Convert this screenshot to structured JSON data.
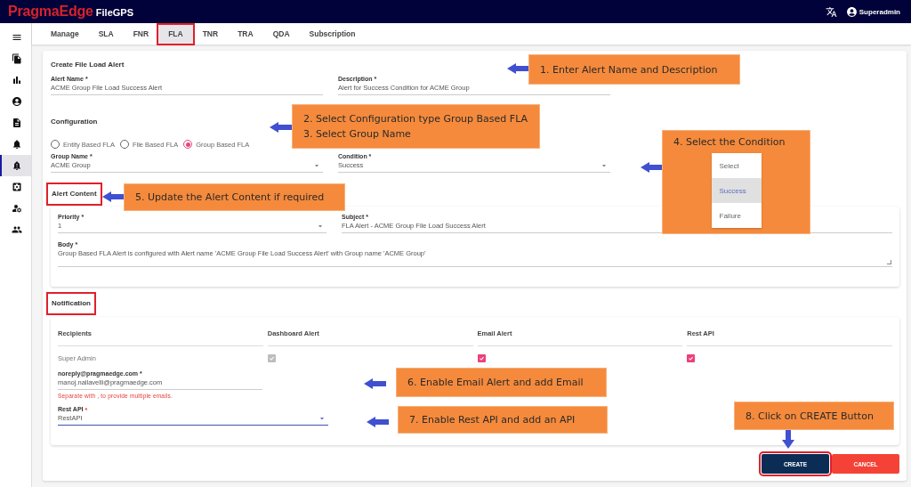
{
  "header": {
    "brand": "PragmaEdge",
    "product": "FileGPS",
    "user": "Superadmin"
  },
  "sidebar": {
    "items": [
      {
        "selected": false
      },
      {
        "selected": false
      },
      {
        "selected": false
      },
      {
        "selected": false
      },
      {
        "selected": false
      },
      {
        "selected": true
      },
      {
        "selected": false
      },
      {
        "selected": false
      },
      {
        "selected": false
      }
    ]
  },
  "tabs": [
    {
      "label": "Manage",
      "selected": false,
      "highlighted": false
    },
    {
      "label": "SLA",
      "selected": false,
      "highlighted": false
    },
    {
      "label": "FNR",
      "selected": false,
      "highlighted": false
    },
    {
      "label": "FLA",
      "selected": true,
      "highlighted": true
    },
    {
      "label": "TNR",
      "selected": false,
      "highlighted": false
    },
    {
      "label": "TRA",
      "selected": false,
      "highlighted": false
    },
    {
      "label": "QDA",
      "selected": false,
      "highlighted": false
    },
    {
      "label": "Subscription",
      "selected": false,
      "highlighted": false
    }
  ],
  "form": {
    "title": "Create File Load Alert",
    "fields": [
      {
        "label": "Alert Name *",
        "value": "ACME Group File Load Success Alert",
        "kind": "text"
      },
      {
        "label": "Description *",
        "value": "Alert for Success Condition for ACME Group",
        "kind": "text"
      }
    ],
    "configuration": {
      "title": "Configuration",
      "options": [
        {
          "label": "Entity Based FLA",
          "selected": false
        },
        {
          "label": "File Based FLA",
          "selected": false
        },
        {
          "label": "Group Based FLA",
          "selected": true
        }
      ],
      "fields": [
        {
          "label": "Group Name *",
          "value": "ACME Group",
          "kind": "select"
        },
        {
          "label": "Condition *",
          "value": "Success",
          "kind": "select"
        }
      ]
    },
    "alert_content": {
      "title": "Alert Content",
      "highlighted": true,
      "fields": [
        {
          "label": "Priority *",
          "value": "1",
          "kind": "select"
        },
        {
          "label": "Subject *",
          "value": "FLA Alert - ACME Group File Load Success Alert",
          "kind": "text"
        }
      ],
      "body": {
        "label": "Body *",
        "value": "Group Based FLA Alert is configured with Alert name 'ACME Group File Load Success Alert' with Group name 'ACME Group'"
      }
    },
    "notification": {
      "title": "Notification",
      "highlighted": true,
      "columns": [
        "Recipients",
        "Dashboard Alert",
        "Email Alert",
        "Rest API"
      ],
      "recipient": "Super Admin",
      "checks": [
        {
          "checked": true,
          "disabled": true
        },
        {
          "checked": true,
          "disabled": false
        },
        {
          "checked": true,
          "disabled": false
        }
      ],
      "email": {
        "label": "noreply@pragmaedge.com *",
        "value": "manoj.nallavelli@pragmaedge.com",
        "helper": "Separate with , to provide multiple emails."
      },
      "rest_api": {
        "label": "Rest API",
        "required_mark": "*",
        "value": "RestAPI",
        "focused": true
      }
    },
    "buttons": [
      {
        "label": "CREATE",
        "kind": "primary",
        "highlighted": true
      },
      {
        "label": "CANCEL",
        "kind": "danger",
        "highlighted": false
      }
    ]
  },
  "callouts": [
    {
      "lines": [
        "1. Enter Alert Name and Description"
      ]
    },
    {
      "lines": [
        "2. Select Configuration type Group Based FLA",
        "3. Select Group Name"
      ]
    },
    {
      "lines": [
        "4. Select the Condition"
      ],
      "menu": [
        {
          "label": "Select",
          "selected": false
        },
        {
          "label": "Success",
          "selected": true
        },
        {
          "label": "Failure",
          "selected": false
        }
      ]
    },
    {
      "lines": [
        "5. Update the Alert Content if required"
      ]
    },
    {
      "lines": [
        "6. Enable Email Alert and add Email"
      ]
    },
    {
      "lines": [
        "7. Enable Rest API and add an API"
      ]
    },
    {
      "lines": [
        "8. Click on CREATE Button"
      ]
    }
  ]
}
